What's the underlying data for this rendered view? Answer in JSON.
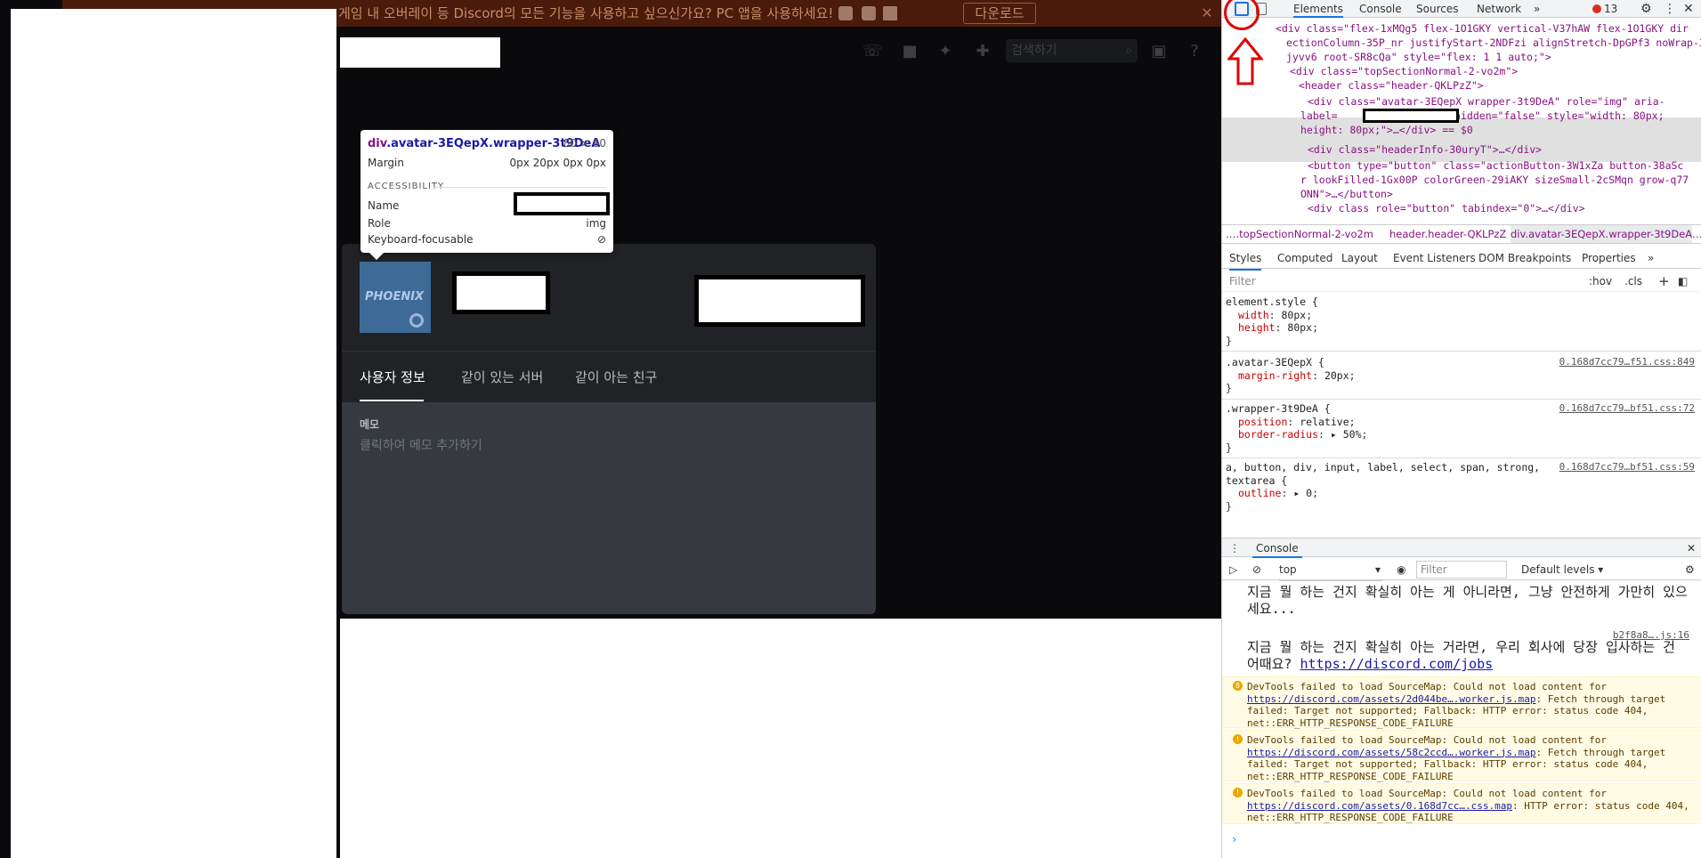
{
  "banner": {
    "message": "게임 내 오버레이 등 Discord의 모든 기능을 사용하고 싶으신가요? PC 앱을 사용하세요!",
    "download_label": "다운로드",
    "close_glyph": "✕"
  },
  "header": {
    "search_placeholder": "검색하기"
  },
  "tooltip": {
    "selector_tag": "div",
    "selector_classes": ".avatar-3EQepX.wrapper-3t9DeA",
    "size": "80 × 80",
    "margin_label": "Margin",
    "margin_value": "0px 20px 0px 0px",
    "accessibility_label": "ACCESSIBILITY",
    "name_label": "Name",
    "role_label": "Role",
    "role_value": "img",
    "focusable_label": "Keyboard-focusable"
  },
  "profile": {
    "avatar_text": "PHOENIX",
    "tabs": [
      "사용자 정보",
      "같이 있는 서버",
      "같이 아는 친구"
    ],
    "memo_label": "메모",
    "memo_placeholder": "클릭하여 메모 추가하기"
  },
  "devtools": {
    "tabs": [
      "Elements",
      "Console",
      "Sources",
      "Network"
    ],
    "more_tabs": "»",
    "error_count": "13",
    "dom_lines": [
      "<div class=\"flex-1xMQg5 flex-1O1GKY vertical-V37hAW flex-1O1GKY dir",
      "ectionColumn-35P_nr justifyStart-2NDFzi alignStretch-DpGPf3 noWrap-3",
      "jyvv6 root-SR8cQa\" style=\"flex: 1 1 auto;\">",
      "<div class=\"topSectionNormal-2-vo2m\">",
      "<header class=\"header-QKLPzZ\">",
      "<div class=\"avatar-3EQepX wrapper-3t9DeA\" role=\"img\" aria-",
      "label=            \" aria-hidden=\"false\" style=\"width: 80px;",
      "height: 80px;\">…</div> == $0",
      "<div class=\"headerInfo-30uryT\">…</div>",
      "<button type=\"button\" class=\"actionButton-3W1xZa button-38aSc",
      "r lookFilled-1Gx00P colorGreen-29iAKY sizeSmall-2cSMqn grow-q77",
      "ONN\">…</button>",
      "<div class role=\"button\" tabindex=\"0\">…</div>"
    ],
    "breadcrumbs": [
      "….topSectionNormal-2-vo2m",
      "header.header-QKLPzZ",
      "div.avatar-3EQepX.wrapper-3t9DeA",
      "…"
    ],
    "sub_tabs": [
      "Styles",
      "Computed",
      "Layout",
      "Event Listeners",
      "DOM Breakpoints",
      "Properties",
      "»"
    ],
    "filter_placeholder": "Filter",
    "hov_label": ":hov",
    "cls_label": ".cls",
    "plus_label": "+",
    "styles": [
      {
        "selector": "element.style {",
        "props": [
          [
            "width",
            "80px"
          ],
          [
            "height",
            "80px"
          ]
        ],
        "source": ""
      },
      {
        "selector": ".avatar-3EQepX {",
        "props": [
          [
            "margin-right",
            "20px"
          ]
        ],
        "source": "0.168d7cc79…f51.css:849"
      },
      {
        "selector": ".wrapper-3t9DeA {",
        "props": [
          [
            "position",
            "relative"
          ],
          [
            "border-radius",
            "▸ 50%"
          ]
        ],
        "source": "0.168d7cc79…bf51.css:72"
      },
      {
        "selector": "a, button, div, input, label, select, span, strong,",
        "selector2": "textarea {",
        "props": [
          [
            "outline",
            "▸ 0"
          ]
        ],
        "source": "0.168d7cc79…bf51.css:59"
      }
    ],
    "console": {
      "title": "Console",
      "context": "top",
      "filter_placeholder": "Filter",
      "levels": "Default levels ▾",
      "messages": [
        {
          "kind": "big",
          "text": "지금 뭘 하는 건지 확실히 아는 게 아니라면, 그냥 안전하게 가만히 있으세요..."
        },
        {
          "kind": "big",
          "source": "b2f8a8….js:16",
          "text": "지금 뭘 하는 건지 확실히 아는 거라면, 우리 회사에 당장 입사하는 건 어때요?",
          "link": "https://discord.com/jobs"
        },
        {
          "kind": "warn",
          "badge": "8",
          "prefix": "DevTools failed to load SourceMap: Could not load content for ",
          "link": "https://discord.com/assets/2d044be….worker.js.map",
          "suffix": ": Fetch through target failed: Target not supported; Fallback: HTTP error: status code 404, net::ERR_HTTP_RESPONSE_CODE_FAILURE"
        },
        {
          "kind": "warn",
          "badge": "!",
          "prefix": "DevTools failed to load SourceMap: Could not load content for ",
          "link": "https://discord.com/assets/58c2ccd….worker.js.map",
          "suffix": ": Fetch through target failed: Target not supported; Fallback: HTTP error: status code 404, net::ERR_HTTP_RESPONSE_CODE_FAILURE"
        },
        {
          "kind": "warn",
          "badge": "!",
          "prefix": "DevTools failed to load SourceMap: Could not load content for ",
          "link": "https://discord.com/assets/0.168d7cc….css.map",
          "suffix": ": HTTP error: status code 404, net::ERR_HTTP_RESPONSE_CODE_FAILURE"
        }
      ],
      "prompt": "›"
    }
  }
}
